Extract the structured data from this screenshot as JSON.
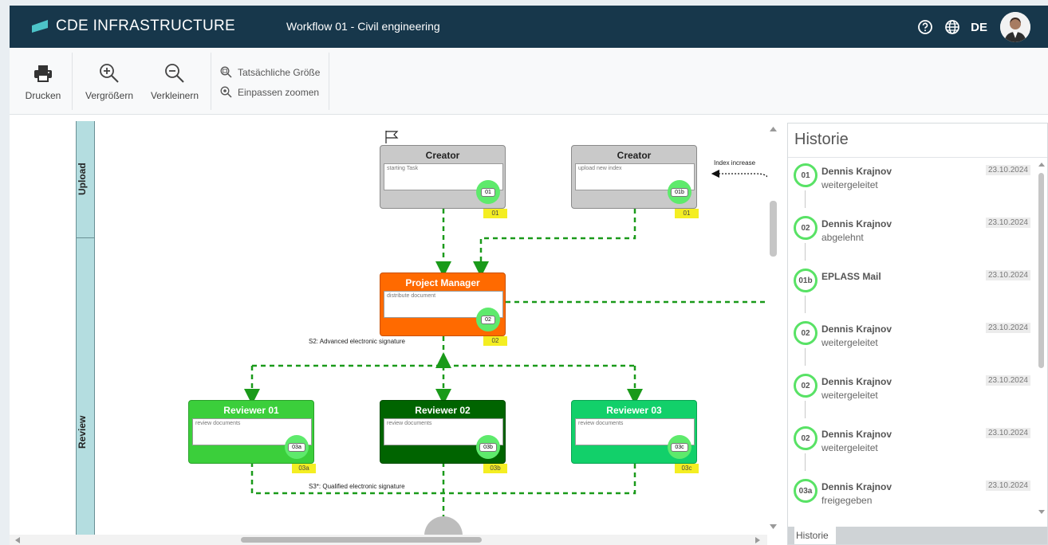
{
  "app": {
    "title": "CDE INFRASTRUCTURE",
    "workflow_title": "Workflow 01 - Civil engineering",
    "language": "DE"
  },
  "toolbar": {
    "print": "Drucken",
    "zoom_in": "Vergrößern",
    "zoom_out": "Verkleinern",
    "actual_size": "Tatsächliche Größe",
    "fit_zoom": "Einpassen zoomen"
  },
  "lanes": {
    "upload": "Upload",
    "review": "Review"
  },
  "nodes": {
    "creator1": {
      "title": "Creator",
      "desc": "starting Task",
      "badge": "01",
      "tag": "01"
    },
    "creator2": {
      "title": "Creator",
      "desc": "upload new index",
      "badge": "01b",
      "tag": "01"
    },
    "pm": {
      "title": "Project Manager",
      "desc": "distribute document",
      "badge": "02",
      "tag": "02"
    },
    "rev1": {
      "title": "Reviewer 01",
      "desc": "review documents",
      "badge": "03a",
      "tag": "03a"
    },
    "rev2": {
      "title": "Reviewer 02",
      "desc": "review documents",
      "badge": "03b",
      "tag": "03b"
    },
    "rev3": {
      "title": "Reviewer 03",
      "desc": "review documents",
      "badge": "03c",
      "tag": "03c"
    }
  },
  "labels": {
    "index_increase": "Index increase",
    "s2": "S2: Advanced electronic signature",
    "s3": "S3*: Qualified electronic signature"
  },
  "colors": {
    "grey": "#c9c9c9",
    "orange": "#ff6a00",
    "green1": "#3bcf3b",
    "green2": "#006400",
    "green3": "#12d06a",
    "connector": "#1a9a1a"
  },
  "history": {
    "title": "Historie",
    "tab": "Historie",
    "items": [
      {
        "step": "01",
        "name": "Dennis Krajnov",
        "status": "weitergeleitet",
        "date": "23.10.2024"
      },
      {
        "step": "02",
        "name": "Dennis Krajnov",
        "status": "abgelehnt",
        "date": "23.10.2024"
      },
      {
        "step": "01b",
        "name": "EPLASS Mail",
        "status": "",
        "date": "23.10.2024"
      },
      {
        "step": "02",
        "name": "Dennis Krajnov",
        "status": "weitergeleitet",
        "date": "23.10.2024"
      },
      {
        "step": "02",
        "name": "Dennis Krajnov",
        "status": "weitergeleitet",
        "date": "23.10.2024"
      },
      {
        "step": "02",
        "name": "Dennis Krajnov",
        "status": "weitergeleitet",
        "date": "23.10.2024"
      },
      {
        "step": "03a",
        "name": "Dennis Krajnov",
        "status": "freigegeben",
        "date": "23.10.2024"
      }
    ]
  }
}
